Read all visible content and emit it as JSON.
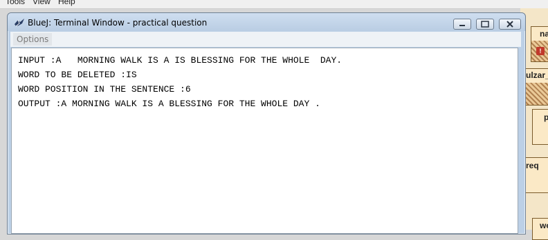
{
  "background_app": {
    "menu": [
      "Tools",
      "View",
      "Help"
    ],
    "class_labels": [
      "na",
      "ulzar_",
      "p",
      "req",
      "wo"
    ]
  },
  "window": {
    "title": "BlueJ: Terminal Window - practical question",
    "menu": {
      "options_label": "Options"
    }
  },
  "terminal": {
    "lines": [
      "INPUT :A   MORNING WALK IS A IS BLESSING FOR THE WHOLE  DAY.",
      "WORD TO BE DELETED :IS",
      "WORD POSITION IN THE SENTENCE :6",
      "OUTPUT :A MORNING WALK IS A BLESSING FOR THE WHOLE DAY ."
    ]
  },
  "icons": {
    "app": "bluej-bird-icon",
    "minimize": "minimize-icon",
    "maximize": "maximize-icon",
    "close": "close-icon",
    "error": "error-icon"
  }
}
